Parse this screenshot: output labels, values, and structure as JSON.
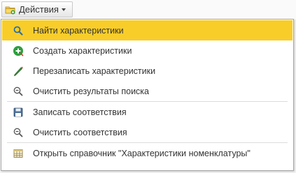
{
  "toolbar": {
    "actions_label": "Действия"
  },
  "menu": {
    "items": [
      {
        "label": "Найти характеристики",
        "icon": "search-icon"
      },
      {
        "label": "Создать характеристики",
        "icon": "add-green-icon"
      },
      {
        "label": "Перезаписать характеристики",
        "icon": "pencil-icon"
      },
      {
        "label": "Очистить результаты поиска",
        "icon": "search-clear-icon"
      },
      {
        "label": "Записать соответствия",
        "icon": "save-icon"
      },
      {
        "label": "Очистить соответствия",
        "icon": "search-clear-icon"
      },
      {
        "label": "Открыть справочник \"Характеристики номенклатуры\"",
        "icon": "table-icon"
      }
    ]
  },
  "colors": {
    "highlight": "#f9cd29",
    "separator": "#dcdcdc",
    "text": "#333333"
  }
}
